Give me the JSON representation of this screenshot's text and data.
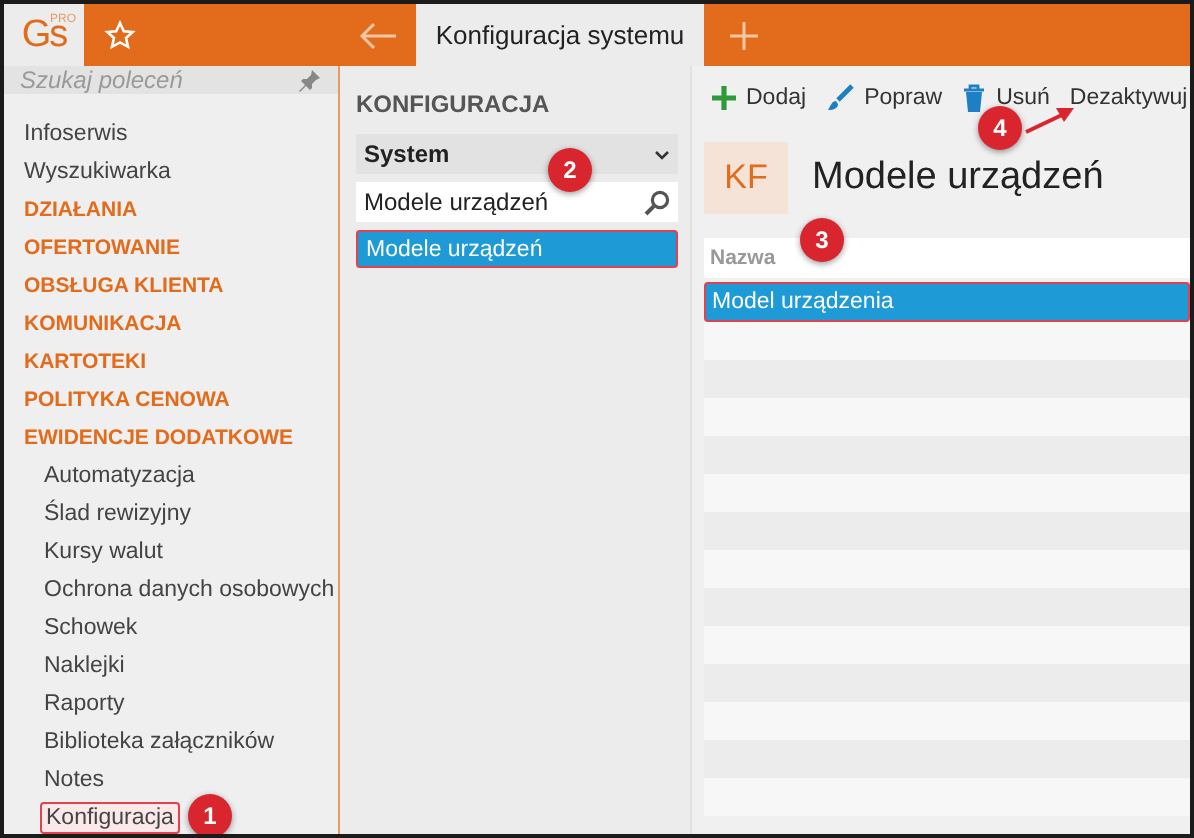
{
  "top_bar": {
    "logo": "Gs",
    "logo_sup": "PRO",
    "tabs": [
      {
        "label": "Konfiguracja systemu",
        "selected": true
      }
    ]
  },
  "sidebar": {
    "search": {
      "placeholder": "Szukaj poleceń"
    },
    "items": [
      {
        "label": "Infoserwis",
        "kind": "link"
      },
      {
        "label": "Wyszukiwarka",
        "kind": "link"
      },
      {
        "label": "DZIAŁANIA",
        "kind": "section"
      },
      {
        "label": "OFERTOWANIE",
        "kind": "section"
      },
      {
        "label": "OBSŁUGA KLIENTA",
        "kind": "section"
      },
      {
        "label": "KOMUNIKACJA",
        "kind": "section"
      },
      {
        "label": "KARTOTEKI",
        "kind": "section"
      },
      {
        "label": "POLITYKA CENOWA",
        "kind": "section"
      },
      {
        "label": "EWIDENCJE DODATKOWE",
        "kind": "section"
      },
      {
        "label": "Automatyzacja",
        "kind": "subitem"
      },
      {
        "label": "Ślad rewizyjny",
        "kind": "subitem"
      },
      {
        "label": "Kursy walut",
        "kind": "subitem"
      },
      {
        "label": "Ochrona danych osobowych",
        "kind": "subitem"
      },
      {
        "label": "Schowek",
        "kind": "subitem"
      },
      {
        "label": "Naklejki",
        "kind": "subitem"
      },
      {
        "label": "Raporty",
        "kind": "subitem"
      },
      {
        "label": "Biblioteka załączników",
        "kind": "subitem"
      },
      {
        "label": "Notes",
        "kind": "subitem"
      },
      {
        "label": "Konfiguracja",
        "kind": "subitem",
        "outlined": true,
        "badge": "1"
      }
    ]
  },
  "config_panel": {
    "title": "KONFIGURACJA",
    "dropdown": "System",
    "search": {
      "value": "Modele urządzeń",
      "badge": "2"
    },
    "items": [
      {
        "label": "Modele urządzeń",
        "selected": true,
        "outlined": true
      }
    ]
  },
  "content": {
    "toolbar": [
      {
        "label": "Dodaj",
        "kind": "add"
      },
      {
        "label": "Popraw",
        "kind": "edit"
      },
      {
        "label": "Usuń",
        "kind": "delete"
      },
      {
        "label": "Dezaktywuj",
        "kind": "plain",
        "badge": "4"
      }
    ],
    "badge": "KF",
    "title": "Modele urządzeń",
    "table": {
      "columns": [
        {
          "label": "Nazwa",
          "badge": "3"
        }
      ],
      "rows": [
        {
          "cells": [
            "Model urządzenia"
          ],
          "selected": true,
          "outlined": true
        }
      ]
    }
  }
}
